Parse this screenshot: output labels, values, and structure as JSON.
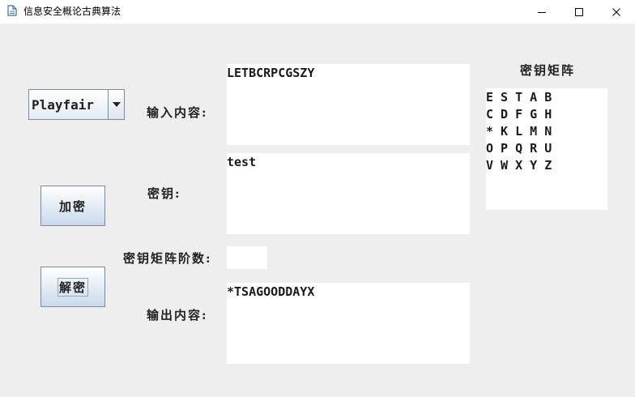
{
  "window": {
    "title": "信息安全概论古典算法",
    "minimize_glyph": "—",
    "maximize_glyph": "☐",
    "close_glyph": "✕"
  },
  "algorithm_select": {
    "selected": "Playfair"
  },
  "labels": {
    "input": "输入内容:",
    "key": "密钥:",
    "matrix_order": "密钥矩阵阶数:",
    "output": "输出内容:"
  },
  "fields": {
    "input_value": "LETBCRPCGSZY",
    "key_value": "test",
    "matrix_order_value": "",
    "output_value": "*TSAGOODDAYX"
  },
  "buttons": {
    "encrypt": "加密",
    "decrypt": "解密"
  },
  "matrix": {
    "title": "密钥矩阵",
    "rows": [
      "E S T A B",
      "C D F G H",
      "* K L M N",
      "O P Q R U",
      "V W X Y Z"
    ]
  },
  "icons": {
    "app": "document-icon",
    "dropdown": "chevron-down-icon"
  }
}
